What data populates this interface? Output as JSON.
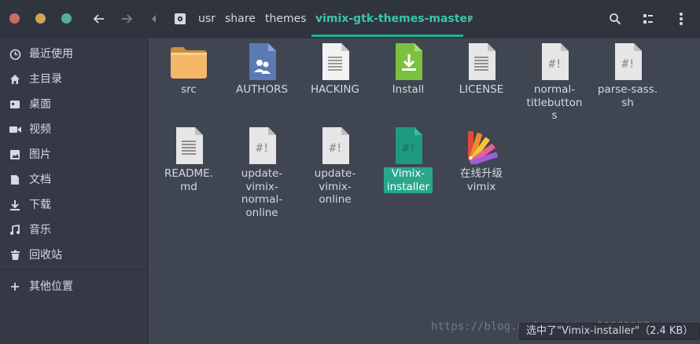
{
  "header": {
    "breadcrumbs": [
      "usr",
      "share",
      "themes",
      "vimix-gtk-themes-master"
    ],
    "accent": "#37c8a6"
  },
  "sidebar": {
    "items": [
      {
        "label": "最近使用",
        "icon": "clock-icon"
      },
      {
        "label": "主目录",
        "icon": "home-icon"
      },
      {
        "label": "桌面",
        "icon": "desktop-icon"
      },
      {
        "label": "视频",
        "icon": "video-icon"
      },
      {
        "label": "图片",
        "icon": "image-icon"
      },
      {
        "label": "文档",
        "icon": "document-icon"
      },
      {
        "label": "下载",
        "icon": "download-icon"
      },
      {
        "label": "音乐",
        "icon": "music-icon"
      },
      {
        "label": "回收站",
        "icon": "trash-icon"
      }
    ],
    "other": {
      "label": "其他位置",
      "icon": "plus-icon"
    }
  },
  "files": [
    {
      "name": "src",
      "icon": "folder-icon"
    },
    {
      "name": "AUTHORS",
      "icon": "authors-file-icon"
    },
    {
      "name": "HACKING",
      "icon": "text-file-icon"
    },
    {
      "name": "Install",
      "icon": "install-file-icon"
    },
    {
      "name": "LICENSE",
      "icon": "text-file-icon"
    },
    {
      "name": "normal-\ntitlebutton\ns",
      "icon": "script-file-icon"
    },
    {
      "name": "parse-sass.\nsh",
      "icon": "script-file-icon"
    },
    {
      "name": "README.\nmd",
      "icon": "text-file-icon"
    },
    {
      "name": "update-\nvimix-\nnormal-\nonline",
      "icon": "script-file-icon"
    },
    {
      "name": "update-\nvimix-\nonline",
      "icon": "script-file-icon"
    },
    {
      "name": "Vimix-\ninstaller",
      "icon": "script-file-icon",
      "selected": true
    },
    {
      "name": "在线升级\nvimix",
      "icon": "color-palette-icon"
    }
  ],
  "status": "选中了\"Vimix-installer\"（2.4 KB）",
  "watermark": "https://blog.csdn.net/qq_28869927"
}
